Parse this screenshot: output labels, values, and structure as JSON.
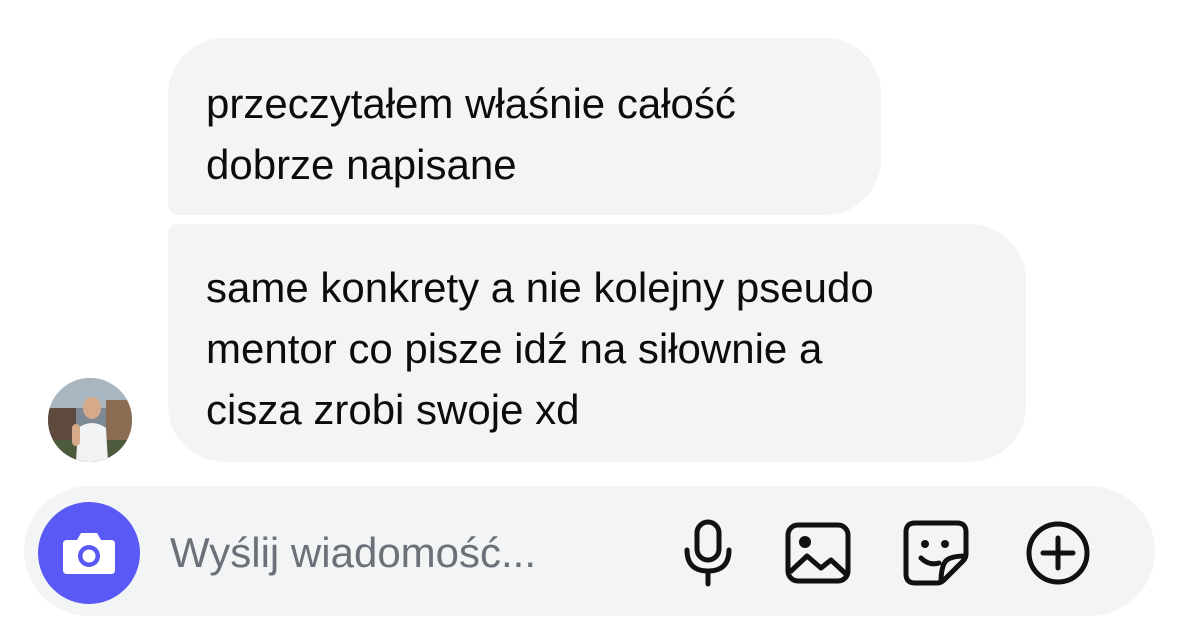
{
  "messages": [
    {
      "lines": [
        "przeczytałem właśnie całość",
        "dobrze napisane"
      ]
    },
    {
      "lines": [
        "same konkrety a nie kolejny pseudo",
        "mentor co pisze idź na siłownie a",
        "cisza zrobi swoje xd"
      ]
    }
  ],
  "composer": {
    "placeholder": "Wyślij wiadomość...",
    "camera_icon": "camera-icon",
    "icons": [
      "microphone-icon",
      "image-icon",
      "sticker-icon",
      "plus-circle-icon"
    ]
  },
  "colors": {
    "bubble_bg": "#f2f4f6",
    "accent": "#5a59f5",
    "placeholder": "#6b7079"
  }
}
